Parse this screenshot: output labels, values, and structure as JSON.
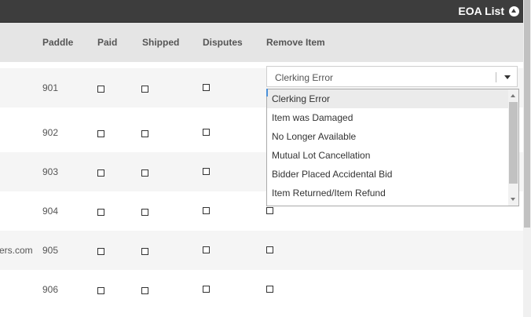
{
  "topbar": {
    "title": "EOA List",
    "collapse_icon": "chevron-up-circle-icon"
  },
  "table": {
    "columns": [
      "Paddle",
      "Paid",
      "Shipped",
      "Disputes",
      "Remove Item"
    ],
    "rows": [
      {
        "email": "",
        "paddle": "901"
      },
      {
        "email": "",
        "paddle": "902"
      },
      {
        "email": "",
        "paddle": "903"
      },
      {
        "email": "",
        "paddle": "904"
      },
      {
        "email": "ers.com",
        "paddle": "905"
      },
      {
        "email": "",
        "paddle": "906"
      }
    ]
  },
  "remove_select": {
    "value": "Clerking Error",
    "options": [
      "Clerking Error",
      "Item was Damaged",
      "No Longer Available",
      "Mutual Lot Cancellation",
      "Bidder Placed Accidental Bid",
      "Item Returned/Item Refund"
    ]
  }
}
